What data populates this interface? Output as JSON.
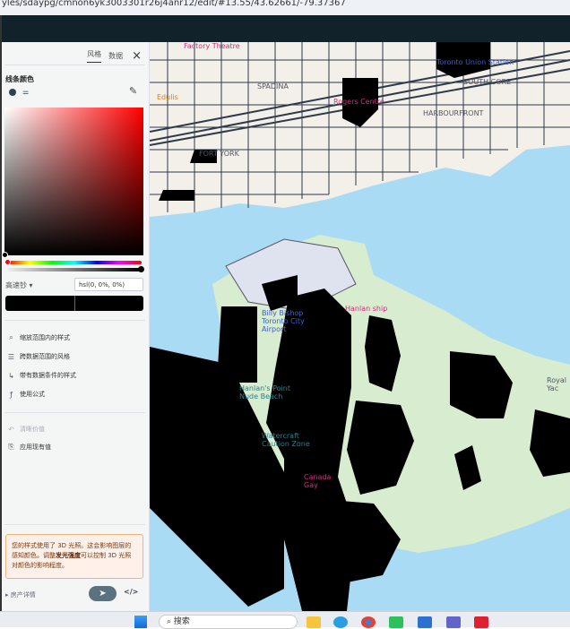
{
  "browser": {
    "url": "yles/sdaypg/cmnon6yk3003301r26j4anr12/edit/#13.55/43.62661/-79.37367"
  },
  "panel": {
    "tabs": [
      {
        "label": "风格",
        "active": true
      },
      {
        "label": "数据",
        "active": false
      }
    ],
    "close_icon": "×",
    "section_label": "线条颜色",
    "color_mode": "高速钞",
    "color_value": "hsl(0, 0%, 0%)",
    "menu": [
      {
        "icon": "zoom-range-icon",
        "label": "缩放范围内的样式"
      },
      {
        "icon": "data-range-icon",
        "label": "跨数据范围的风格"
      },
      {
        "icon": "condition-icon",
        "label": "带有数据条件的样式"
      },
      {
        "icon": "formula-icon",
        "label": "使用公式"
      }
    ],
    "actions": [
      {
        "label": "清晰价值",
        "disabled": true
      },
      {
        "label": "应用现有值",
        "disabled": false
      }
    ],
    "notice": {
      "pre": "您的样式使用了 3D 光照。这会影响图层的感知颜色。调整",
      "bold": "发光强度",
      "post": "可以控制 3D 光照对颜色的影响程度。"
    },
    "footer_label": "房产详情",
    "code_label": "</>"
  },
  "map": {
    "labels": [
      "Factory Theatre",
      "Toronto Union Station",
      "Edulis",
      "SPADINA",
      "FORT YORK",
      "Rogers Centre",
      "HARBOURFRONT",
      "SOUTH CORE",
      "Billy Bishop Toronto City Airport",
      "Hanlan ship",
      "Hanlan's Point Nude Beach",
      "Watercraft Caution Zone",
      "Canada Gay",
      "Royal Yac"
    ],
    "water_color": "#a9dbf5"
  },
  "taskbar": {
    "search_placeholder": "搜索"
  }
}
